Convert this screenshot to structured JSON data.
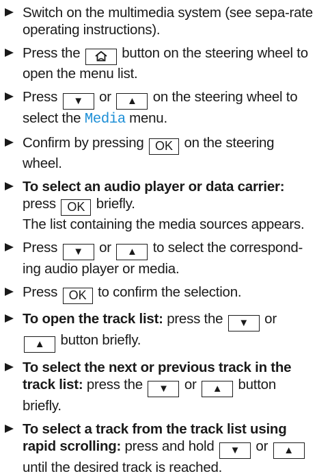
{
  "steps": [
    {
      "text": "Switch on the multimedia system (see sepa-rate operating instructions)."
    },
    {
      "before": "Press the",
      "after": "button on the steering wheel to open the menu list."
    },
    {
      "before": "Press",
      "mid": "or",
      "after_line1": "on the steering wheel to",
      "after_line2_before": "select the",
      "media_word": "Media",
      "after_line2_after": "menu."
    },
    {
      "before": "Confirm by pressing",
      "ok": "OK",
      "after": "on the steering wheel."
    },
    {
      "bold": "To select an audio player or data carrier:",
      "before": "press",
      "ok": "OK",
      "after": "briefly.",
      "note": "The list containing the media sources appears."
    },
    {
      "before": "Press",
      "mid": "or",
      "after": "to select the correspond-ing audio player or media."
    },
    {
      "before": "Press",
      "ok": "OK",
      "after": "to confirm the selection."
    },
    {
      "bold": "To open the track list:",
      "before": "press the",
      "mid": "or",
      "after": "button briefly."
    },
    {
      "bold_line1": "To select the next or previous track in the",
      "bold_line2": "track list:",
      "before": "press the",
      "mid": "or",
      "after": "button briefly."
    },
    {
      "bold_line1": "To select a track from the track list using",
      "bold_line2": "rapid scrolling:",
      "before": "press and hold",
      "mid": "or",
      "after": "until the desired track is reached."
    }
  ],
  "icons": {
    "down": "▼",
    "up": "▲",
    "home": "home-icon"
  }
}
